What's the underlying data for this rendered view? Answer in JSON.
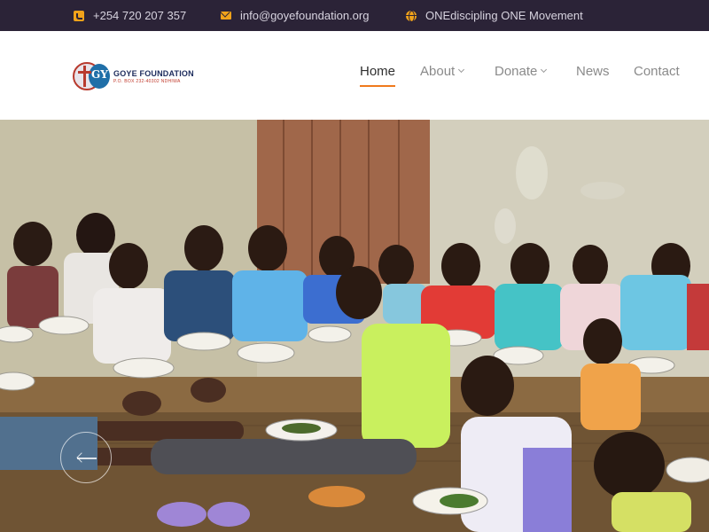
{
  "topbar": {
    "phone": "+254 720 207 357",
    "email": "info@goyefoundation.org",
    "movement": "ONEdiscipling ONE Movement",
    "icons": [
      "phone-icon",
      "mail-icon",
      "globe-icon"
    ],
    "accent_color": "#f0a21a",
    "background": "#2b2337"
  },
  "logo": {
    "mark_text": "GY",
    "name": "GOYE FOUNDATION",
    "tagline": "P.O. BOX 232-40302 NDHIWA"
  },
  "nav": {
    "items": [
      {
        "label": "Home",
        "active": true
      },
      {
        "label": "About",
        "has_dropdown": true
      },
      {
        "label": "Donate",
        "has_dropdown": true
      },
      {
        "label": "News"
      },
      {
        "label": "Contact"
      }
    ],
    "active_color": "#f07a1c"
  },
  "hero": {
    "image": "photo of children seated on a wooden floor eating meals from plates",
    "prev_icon": "arrow-left-icon"
  }
}
